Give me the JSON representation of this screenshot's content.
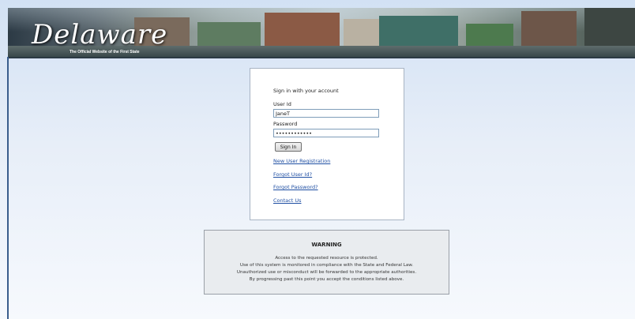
{
  "banner": {
    "logo_title": "Delaware",
    "logo_subtitle": "The Official Website of the First State"
  },
  "login": {
    "heading": "Sign in with your account",
    "user_label": "User Id",
    "user_value": "JaneT",
    "password_label": "Password",
    "password_value": "••••••••••••",
    "signin_label": "Sign In",
    "links": {
      "new_user": "New User Registration",
      "forgot_user": "Forgot User Id?",
      "forgot_password": "Forgot Password?",
      "contact": "Contact Us"
    }
  },
  "warning": {
    "title": "WARNING",
    "lines": [
      "Access to the requested resource is protected.",
      "Use of this system is monitored in compliance with the State and Federal Law.",
      "Unauthorized use or misconduct will be forwarded to the appropriate authorities.",
      "By progressing past this point you accept the conditions listed above."
    ]
  },
  "colors": {
    "link": "#1f4fa3",
    "page_background": "#dce7f5",
    "left_rule": "#3a5d8c"
  }
}
